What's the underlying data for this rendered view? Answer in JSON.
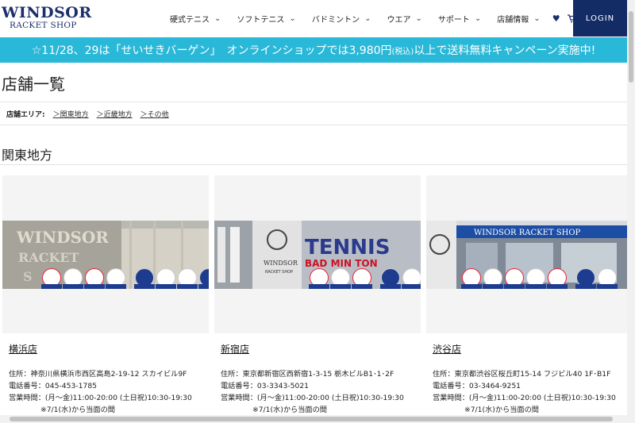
{
  "header": {
    "logo_line1": "WINDSOR",
    "logo_line2": "RACKET SHOP",
    "nav": [
      {
        "label": "硬式テニス"
      },
      {
        "label": "ソフトテニス"
      },
      {
        "label": "バドミントン"
      },
      {
        "label": "ウエア"
      },
      {
        "label": "サポート"
      },
      {
        "label": "店舗情報"
      }
    ],
    "login_label": "LOGIN",
    "accent_color": "#132c66"
  },
  "banner": {
    "text_before": "☆11/28、29は「せいせきバーゲン」　オンラインショップでは3,980円",
    "text_small": "(税込)",
    "text_after": "以上で送料無料キャンペーン実施中!",
    "color": "#29b8d8"
  },
  "page_title": "店舗一覧",
  "areas": {
    "label": "店舗エリア:",
    "links": [
      "＞関東地方",
      "＞近畿地方",
      "＞その他"
    ]
  },
  "section_title": "関東地方",
  "stores": [
    {
      "name": "横浜店",
      "address": "住所：神奈川県横浜市西区高島2-19-12 スカイビル9F",
      "phone": "電話番号：045-453-1785",
      "hours": "営業時間：(月〜金)11:00-20:00 (土日祝)10:30-19:30",
      "note": "※7/1(水)から当面の間"
    },
    {
      "name": "新宿店",
      "address": "住所：東京都新宿区西新宿1-3-15 栃木ビルB1･1･2F",
      "phone": "電話番号：03-3343-5021",
      "hours": "営業時間：(月〜金)11:00-20:00 (土日祝)10:30-19:30",
      "note": "※7/1(水)から当面の間"
    },
    {
      "name": "渋谷店",
      "address": "住所：東京都渋谷区桜丘町15-14 フジビル40 1F･B1F",
      "phone": "電話番号：03-3464-9251",
      "hours": "営業時間：(月〜金)11:00-20:00 (土日祝)10:30-19:30",
      "note": "※7/1(水)から当面の間"
    }
  ]
}
